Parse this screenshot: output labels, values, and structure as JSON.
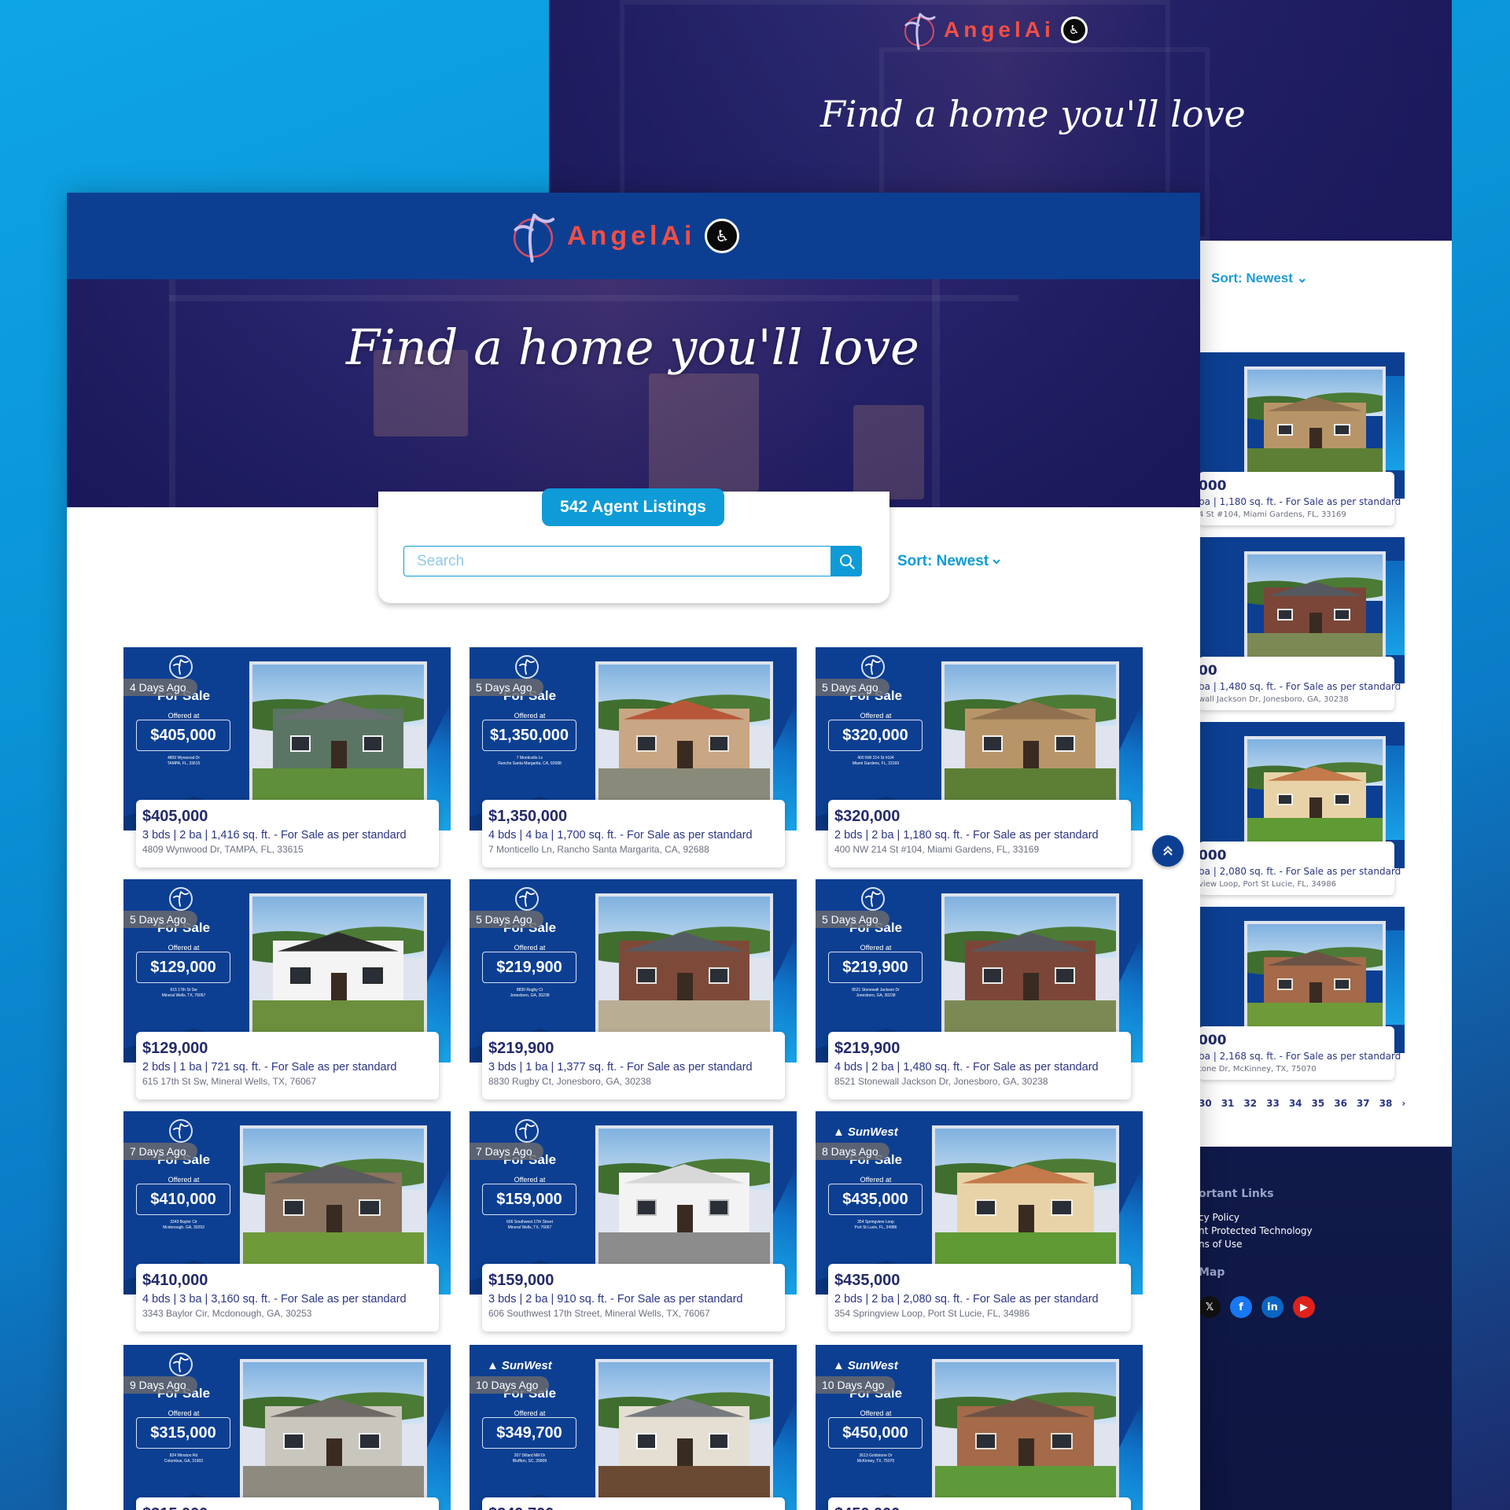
{
  "brand": {
    "name": "AngelAi",
    "colors": {
      "header_blue": "#0c3f92",
      "accent_blue": "#0e9bd8",
      "logo_red": "#f04e46"
    }
  },
  "hero": {
    "title": "Find a home you'll love"
  },
  "search": {
    "listings_count_label": "542 Agent Listings",
    "placeholder": "Search",
    "value": "",
    "search_icon": "search-icon",
    "sort_label": "Sort: Newest",
    "sort_icon": "chevron-down-icon"
  },
  "listings": [
    {
      "days_ago": "4 Days Ago",
      "price": "$405,000",
      "details": "3 bds | 2 ba | 1,416 sq. ft. - For Sale as per standard",
      "address": "4809 Wynwood Dr, TAMPA, FL, 33615",
      "flyer_address": "4809 Wynwood Dr\nTAMPA, FL, 33615",
      "flyer_brand": "angelai",
      "for_sale": "For Sale",
      "offered_at": "Offered at",
      "photo": {
        "body": "#5b7564",
        "roof": "#6b6e73",
        "trim": "#f2f2f2",
        "ground": "#5f8f3a"
      }
    },
    {
      "days_ago": "5 Days Ago",
      "price": "$1,350,000",
      "details": "4 bds | 4 ba | 1,700 sq. ft. - For Sale as per standard",
      "address": "7 Monticello Ln, Rancho Santa Margarita, CA, 92688",
      "flyer_address": "7 Monticello Ln\nRancho Santa Margarita, CA, 92688",
      "flyer_brand": "angelai",
      "for_sale": "For Sale",
      "offered_at": "Offered at",
      "photo": {
        "body": "#c9a684",
        "roof": "#b8563a",
        "trim": "#efe5d8",
        "ground": "#8a8a7a"
      }
    },
    {
      "days_ago": "5 Days Ago",
      "price": "$320,000",
      "details": "2 bds | 2 ba | 1,180 sq. ft. - For Sale as per standard",
      "address": "400 NW 214 St #104, Miami Gardens, FL, 33169",
      "flyer_address": "400 NW 214 St #104\nMiami Gardens, FL, 33169",
      "flyer_brand": "angelai",
      "for_sale": "For Sale",
      "offered_at": "Offered at",
      "photo": {
        "body": "#b89568",
        "roof": "#8f7150",
        "trim": "#f4f1ea",
        "ground": "#5d7f35"
      }
    },
    {
      "days_ago": "5 Days Ago",
      "price": "$129,000",
      "details": "2 bds | 1 ba | 721 sq. ft. - For Sale as per standard",
      "address": "615 17th St Sw, Mineral Wells, TX, 76067",
      "flyer_address": "615 17th St Sw\nMineral Wells, TX, 76067",
      "flyer_brand": "angelai",
      "for_sale": "For Sale",
      "offered_at": "Offered at",
      "photo": {
        "body": "#f4f4f4",
        "roof": "#2b2b2b",
        "trim": "#2b2b2b",
        "ground": "#6b8f3d"
      }
    },
    {
      "days_ago": "5 Days Ago",
      "price": "$219,900",
      "details": "3 bds | 1 ba | 1,377 sq. ft. - For Sale as per standard",
      "address": "8830 Rugby Ct, Jonesboro, GA, 30238",
      "flyer_address": "8830 Rugby Ct\nJonesboro, GA, 30238",
      "flyer_brand": "angelai",
      "for_sale": "For Sale",
      "offered_at": "Offered at",
      "photo": {
        "body": "#7d4a3a",
        "roof": "#555b62",
        "trim": "#e9e6df",
        "ground": "#b9ad94"
      }
    },
    {
      "days_ago": "5 Days Ago",
      "price": "$219,900",
      "details": "4 bds | 2 ba | 1,480 sq. ft. - For Sale as per standard",
      "address": "8521 Stonewall Jackson Dr, Jonesboro, GA, 30238",
      "flyer_address": "8521 Stonewall Jackson Dr\nJonesboro, GA, 30238",
      "flyer_brand": "angelai",
      "for_sale": "For Sale",
      "offered_at": "Offered at",
      "photo": {
        "body": "#7b4638",
        "roof": "#55595f",
        "trim": "#ecebe6",
        "ground": "#7b8a55"
      }
    },
    {
      "days_ago": "7 Days Ago",
      "price": "$410,000",
      "details": "4 bds | 3 ba | 3,160 sq. ft. - For Sale as per standard",
      "address": "3343 Baylor Cir, Mcdonough, GA, 30253",
      "flyer_address": "3343 Baylor Cir\nMcdonough, GA, 30253",
      "flyer_brand": "angelai",
      "for_sale": "For Sale",
      "offered_at": "Offered at",
      "photo": {
        "body": "#8b7360",
        "roof": "#5b5a5c",
        "trim": "#f0ece4",
        "ground": "#6f9a3a"
      }
    },
    {
      "days_ago": "7 Days Ago",
      "price": "$159,000",
      "details": "3 bds | 2 ba | 910 sq. ft. - For Sale as per standard",
      "address": "606 Southwest 17th Street, Mineral Wells, TX, 76067",
      "flyer_address": "606 Southwest 17th Street\nMineral Wells, TX, 76067",
      "flyer_brand": "angelai",
      "for_sale": "For Sale",
      "offered_at": "Offered at",
      "photo": {
        "body": "#f3f3f3",
        "roof": "#d8d8d8",
        "trim": "#bdbdbd",
        "ground": "#8c8c8c"
      }
    },
    {
      "days_ago": "8 Days Ago",
      "price": "$435,000",
      "details": "2 bds | 2 ba | 2,080 sq. ft. - For Sale as per standard",
      "address": "354 Springview Loop, Port St Lucie, FL, 34986",
      "flyer_address": "354 Springview Loop\nPort St Lucie, FL, 34986",
      "flyer_brand": "sunwest",
      "for_sale": "For Sale",
      "offered_at": "Offered at",
      "photo": {
        "body": "#e8d3a9",
        "roof": "#c47a4a",
        "trim": "#f6efe2",
        "ground": "#5f9a34"
      }
    },
    {
      "days_ago": "9 Days Ago",
      "price": "$315,000",
      "details": "",
      "address": "",
      "flyer_address": "824 Winston Rd\nColumbus, GA, 31903",
      "flyer_brand": "angelai",
      "for_sale": "For Sale",
      "offered_at": "Offered at",
      "photo": {
        "body": "#c9c6bd",
        "roof": "#6d6a66",
        "trim": "#efefef",
        "ground": "#8d8a80"
      }
    },
    {
      "days_ago": "10 Days Ago",
      "price": "$349,700",
      "details": "",
      "address": "",
      "flyer_address": "207 Dillard Mill Dr\nBluffton, SC, 29909",
      "flyer_brand": "sunwest",
      "for_sale": "For Sale",
      "offered_at": "Offered at",
      "photo": {
        "body": "#e4dfd2",
        "roof": "#777a7e",
        "trim": "#ffffff",
        "ground": "#6b4a34"
      }
    },
    {
      "days_ago": "10 Days Ago",
      "price": "$450,000",
      "details": "",
      "address": "",
      "flyer_address": "3613 Goldstone Dr\nMcKinney, TX, 75070",
      "flyer_brand": "sunwest",
      "for_sale": "For Sale",
      "offered_at": "Offered at",
      "photo": {
        "body": "#a46a4a",
        "roof": "#6c5245",
        "trim": "#e9ded2",
        "ground": "#5f9a3a"
      }
    }
  ],
  "back_window": {
    "sort_label": "Sort: Newest",
    "cards": [
      {
        "price": "000",
        "details": "ba | 1,180 sq. ft. - For Sale as per standard",
        "address": "4 St #104, Miami Gardens, FL, 33169",
        "photo": {
          "body": "#b89568",
          "roof": "#8f7150",
          "trim": "#f4f1ea",
          "ground": "#5d7f35"
        }
      },
      {
        "price": "00",
        "details": "ba | 1,480 sq. ft. - For Sale as per standard",
        "address": "wall Jackson Dr, Jonesboro, GA, 30238",
        "photo": {
          "body": "#7b4638",
          "roof": "#55595f",
          "trim": "#ecebe6",
          "ground": "#7b8a55"
        }
      },
      {
        "price": "000",
        "details": "ba | 2,080 sq. ft. - For Sale as per standard",
        "address": "view Loop, Port St Lucie, FL, 34986",
        "photo": {
          "body": "#e8d3a9",
          "roof": "#c47a4a",
          "trim": "#f6efe2",
          "ground": "#5f9a34"
        }
      },
      {
        "price": "000",
        "details": "ba | 2,168 sq. ft. - For Sale as per standard",
        "address": "tone Dr, McKinney, TX, 75070",
        "photo": {
          "body": "#a46a4a",
          "roof": "#6c5245",
          "trim": "#e9ded2",
          "ground": "#6f9a3a"
        }
      }
    ],
    "pagination": [
      "30",
      "31",
      "32",
      "33",
      "34",
      "35",
      "36",
      "37",
      "38",
      "›"
    ],
    "footer": {
      "links_heading": "ortant Links",
      "links": [
        "cy Policy",
        "nt Protected Technology",
        "ns of Use"
      ],
      "map_label": "Map",
      "social": [
        {
          "icon": "x-icon",
          "glyph": "𝕏",
          "color": "#111111"
        },
        {
          "icon": "facebook-icon",
          "glyph": "f",
          "color": "#1877f2"
        },
        {
          "icon": "linkedin-icon",
          "glyph": "in",
          "color": "#0a66c2"
        },
        {
          "icon": "youtube-icon",
          "glyph": "▶",
          "color": "#e0211b"
        }
      ]
    }
  }
}
